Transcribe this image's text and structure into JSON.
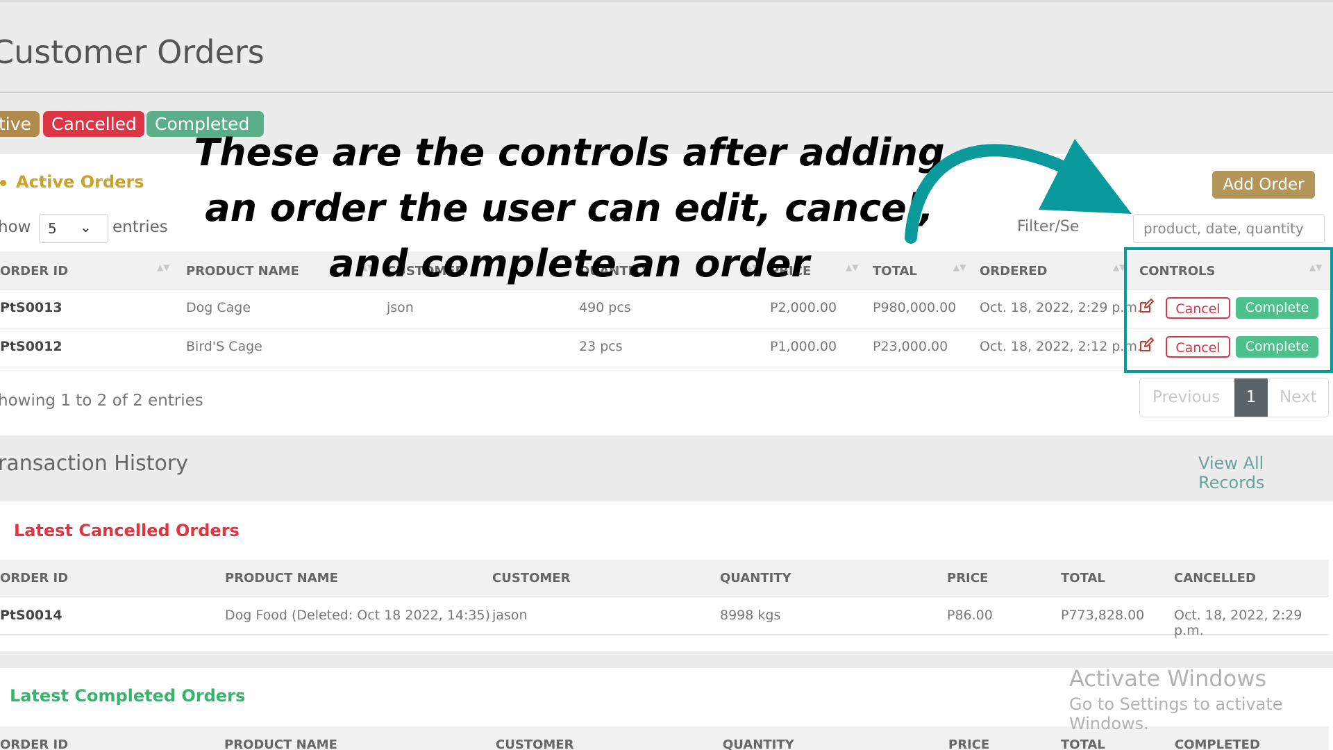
{
  "page": {
    "title": "Customer Orders",
    "status_pills": {
      "active": "tive",
      "cancelled": "Cancelled",
      "completed": "Completed"
    }
  },
  "active_orders": {
    "title": "Active Orders",
    "add_button": "Add Order",
    "show_label": "how",
    "entries_value": "5",
    "entries_label": "entries",
    "filter_label": "Filter/Se",
    "search_placeholder": "product, date, quantity",
    "columns": [
      "ORDER ID",
      "PRODUCT NAME",
      "CUSTOMER",
      "QUANTITY",
      "PRICE",
      "TOTAL",
      "ORDERED",
      "CONTROLS"
    ],
    "rows": [
      {
        "id": "PtS0013",
        "product": "Dog Cage",
        "customer": "json",
        "quantity": "490 pcs",
        "price": "P2,000.00",
        "total": "P980,000.00",
        "ordered": "Oct. 18, 2022, 2:29 p.m.",
        "cancel": "Cancel",
        "complete": "Complete"
      },
      {
        "id": "PtS0012",
        "product": "Bird'S Cage",
        "customer": "",
        "quantity": "23 pcs",
        "price": "P1,000.00",
        "total": "P23,000.00",
        "ordered": "Oct. 18, 2022, 2:12 p.m.",
        "cancel": "Cancel",
        "complete": "Complete"
      }
    ],
    "showing": "howing 1 to 2 of 2 entries",
    "pager": {
      "previous": "Previous",
      "page": "1",
      "next": "Next"
    }
  },
  "transaction_history": {
    "title": "ransaction History",
    "view_all": "View All Records"
  },
  "latest_cancelled": {
    "title": "Latest Cancelled Orders",
    "title_color": "#dc3545",
    "columns": [
      "ORDER ID",
      "PRODUCT NAME",
      "CUSTOMER",
      "QUANTITY",
      "PRICE",
      "TOTAL",
      "CANCELLED"
    ],
    "rows": [
      {
        "id": "PtS0014",
        "product": "Dog Food (Deleted: Oct 18 2022, 14:35)",
        "customer": "jason",
        "quantity": "8998 kgs",
        "price": "P86.00",
        "total": "P773,828.00",
        "date": "Oct. 18, 2022, 2:29 p.m."
      }
    ]
  },
  "latest_completed": {
    "title": "Latest Completed Orders",
    "title_color": "#3bb36a",
    "columns": [
      "ORDER ID",
      "PRODUCT NAME",
      "CUSTOMER",
      "QUANTITY",
      "PRICE",
      "TOTAL",
      "COMPLETED"
    ]
  },
  "overlay": {
    "caption": "These are the controls after adding an order the user can edit, cancel, and complete an order",
    "accent_color": "#0a9a9c"
  },
  "watermark": {
    "line1": "Activate Windows",
    "line2": "Go to Settings to activate Windows."
  }
}
